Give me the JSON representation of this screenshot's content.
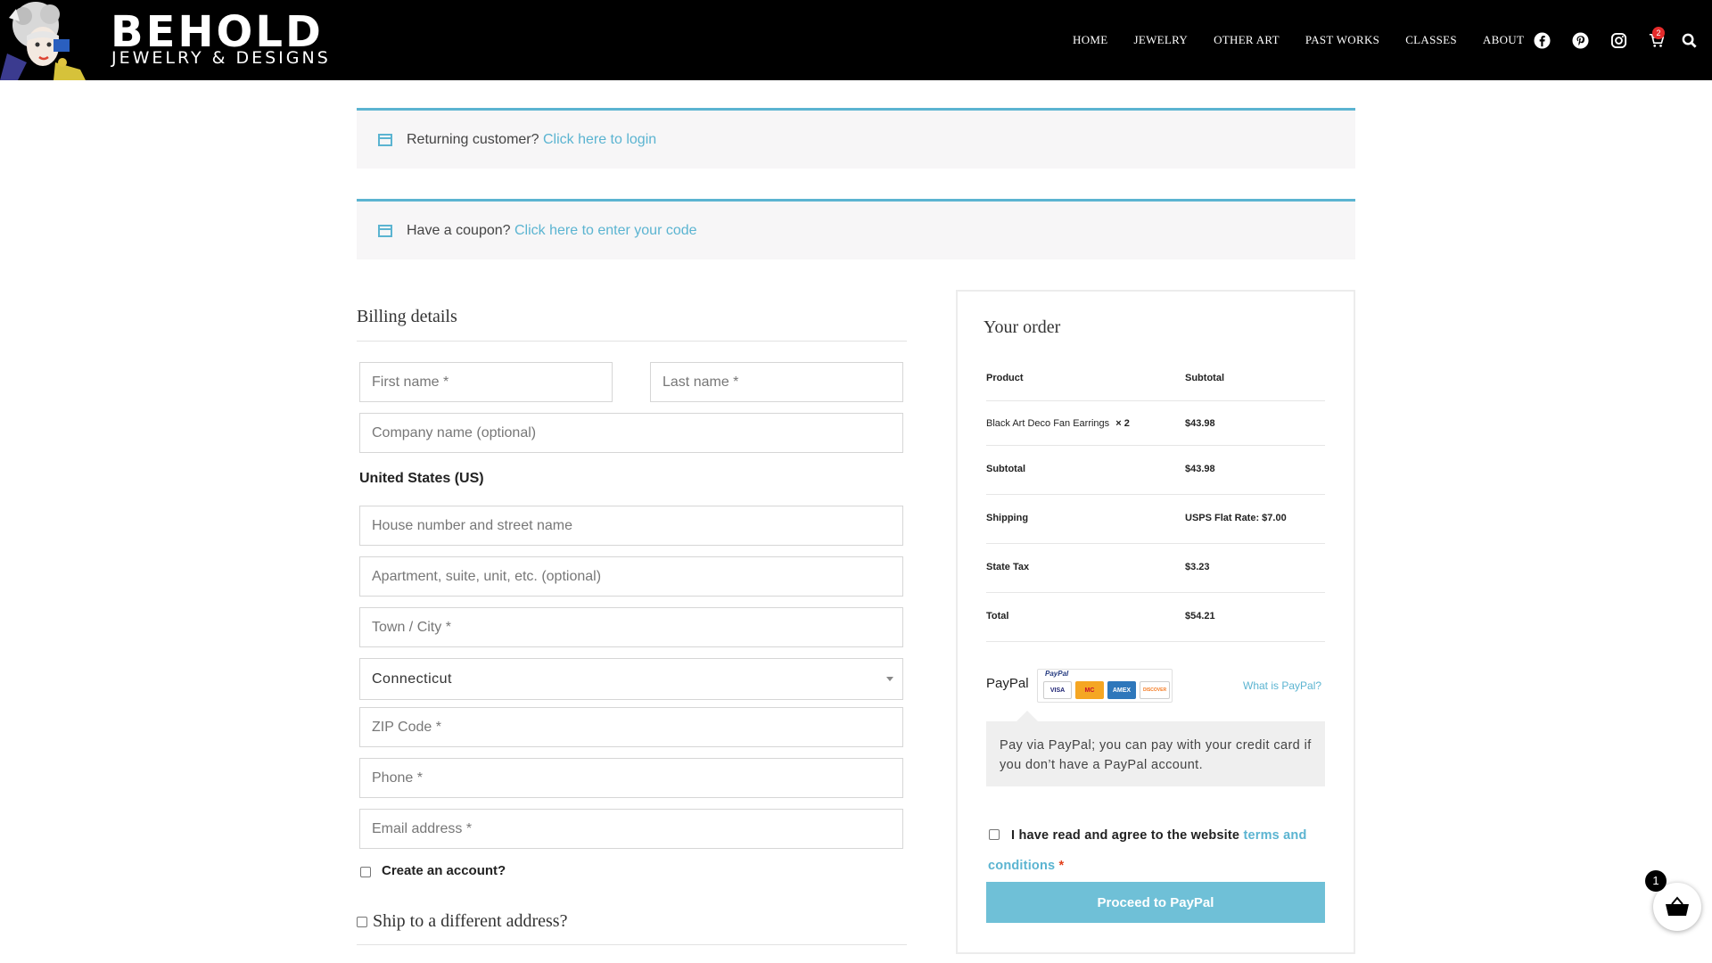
{
  "header": {
    "logo_title": "BEHOLD",
    "logo_subtitle": "JEWELRY & DESIGNS",
    "nav": [
      "HOME",
      "JEWELRY",
      "OTHER ART",
      "PAST WORKS",
      "CLASSES",
      "ABOUT"
    ],
    "icons": [
      "facebook-icon",
      "pinterest-icon",
      "instagram-icon",
      "cart-icon",
      "search-icon"
    ],
    "cart_count": "2"
  },
  "notices": {
    "login": {
      "text": "Returning customer?",
      "link": "Click here to login"
    },
    "coupon": {
      "text": "Have a coupon?",
      "link": "Click here to enter your code"
    }
  },
  "billing": {
    "title": "Billing details",
    "first_name": "First name *",
    "last_name": "Last name *",
    "company": "Company name (optional)",
    "country": "United States (US)",
    "street": "House number and street name",
    "apartment": "Apartment, suite, unit, etc. (optional)",
    "city": "Town / City *",
    "state": "Connecticut",
    "zip": "ZIP Code *",
    "phone": "Phone *",
    "email": "Email address *",
    "create_account": "Create an account?",
    "ship_different": "Ship to a different address?"
  },
  "order": {
    "title": "Your order",
    "col_product": "Product",
    "col_subtotal": "Subtotal",
    "item_name": "Black Art Deco Fan Earrings",
    "item_qty": "× 2",
    "item_price": "$43.98",
    "rows": [
      {
        "label": "Subtotal",
        "value": "$43.98"
      },
      {
        "label": "Shipping",
        "value": "USPS Flat Rate: $7.00"
      },
      {
        "label": "State Tax",
        "value": "$3.23"
      },
      {
        "label": "Total",
        "value": "$54.21"
      }
    ],
    "payment_method": "PayPal",
    "paypal_logo_text": "PayPal",
    "card_names": [
      "VISA",
      "MC",
      "AMEX",
      "DISCOVER"
    ],
    "what_is_paypal": "What is PayPal?",
    "paypal_description": "Pay via PayPal; you can pay with your credit card if you don’t have a PayPal account.",
    "terms_prefix": "I have read and agree to the website",
    "terms_link": "terms and conditions",
    "terms_required": "*",
    "proceed_button": "Proceed to PayPal"
  },
  "floating_cart": {
    "count": "1"
  },
  "colors": {
    "accent": "#5bb4d1",
    "button": "#6fc0d7",
    "header_bg": "#000000"
  }
}
